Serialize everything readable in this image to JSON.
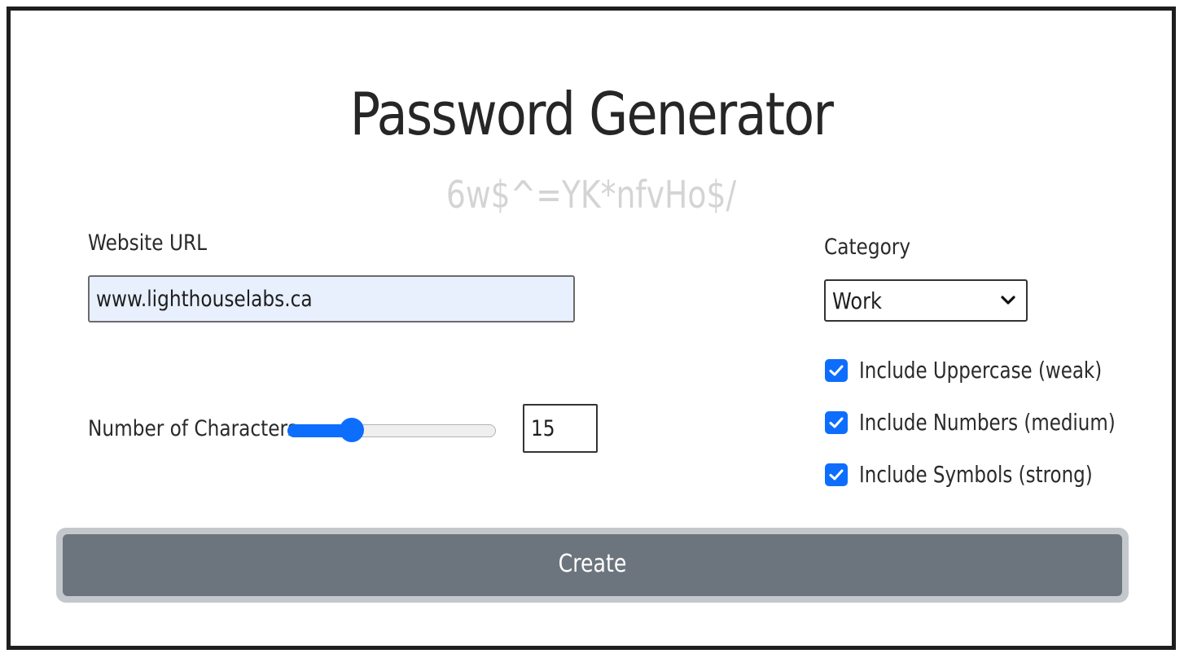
{
  "app": {
    "title": "Password Generator",
    "generated_password": "6w$^=YK*nfvHo$/"
  },
  "form": {
    "url_label": "Website URL",
    "url_value": "www.lighthouselabs.ca",
    "length_label": "Number of Characters",
    "length_value": "15",
    "length_slider_fraction": 0.31,
    "category_label": "Category",
    "category_selected": "Work",
    "options": [
      {
        "label": "Include Uppercase (weak)",
        "checked": true
      },
      {
        "label": "Include Numbers (medium)",
        "checked": true
      },
      {
        "label": "Include Symbols (strong)",
        "checked": true
      }
    ],
    "create_label": "Create"
  },
  "colors": {
    "accent": "#0d6efd",
    "button": "#6c757d",
    "input_autofill": "#e8f0fe",
    "password_text": "#d4d4d4"
  },
  "icons": {
    "select_arrow": "chevron-down-icon",
    "checkbox_mark": "checkmark-icon"
  }
}
